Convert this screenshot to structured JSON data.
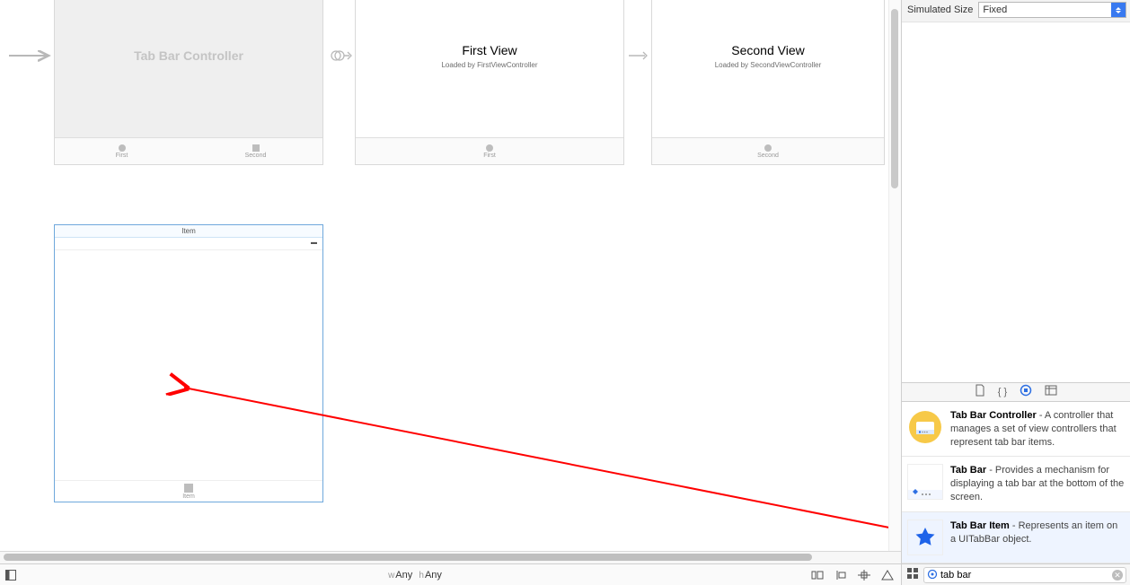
{
  "simulated_size": {
    "label": "Simulated Size",
    "value": "Fixed"
  },
  "scenes": {
    "tab_bar_controller": {
      "title": "Tab Bar Controller",
      "tabs": [
        {
          "label": "First",
          "shape": "dot"
        },
        {
          "label": "Second",
          "shape": "sq"
        }
      ]
    },
    "first_view": {
      "title": "First View",
      "subtitle": "Loaded by FirstViewController",
      "tabs": [
        {
          "label": "First",
          "shape": "dot"
        }
      ]
    },
    "second_view": {
      "title": "Second View",
      "subtitle": "Loaded by SecondViewController",
      "tabs": [
        {
          "label": "Second",
          "shape": "dot"
        }
      ]
    },
    "new_scene": {
      "header": "Item",
      "tab_item_label": "Item"
    }
  },
  "size_class": {
    "w_prefix": "w",
    "w": "Any",
    "h_prefix": "h",
    "h": "Any"
  },
  "library": {
    "filter_value": "tab bar",
    "items": {
      "tbc": {
        "title": "Tab Bar Controller",
        "desc": " - A controller that manages a set of view controllers that represent tab bar items."
      },
      "tb": {
        "title": "Tab Bar",
        "desc": " - Provides a mechanism for displaying a tab bar at the bottom of the screen."
      },
      "tbi": {
        "title": "Tab Bar Item",
        "desc": " - Represents an item on a UITabBar object."
      }
    }
  }
}
